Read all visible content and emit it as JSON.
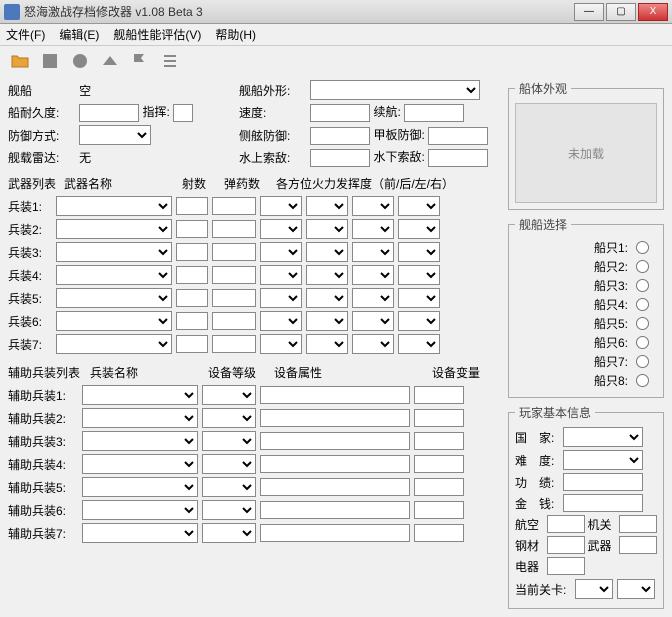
{
  "window": {
    "title": "怒海激战存档修改器 v1.08 Beta 3"
  },
  "menu": {
    "file": "文件(F)",
    "edit": "编辑(E)",
    "eval": "舰船性能评估(V)",
    "help": "帮助(H)"
  },
  "ship": {
    "ship_label": "舰船",
    "ship_value": "空",
    "shape_label": "舰船外形:",
    "hp_label": "船耐久度:",
    "command_label": "指挥:",
    "speed_label": "速度:",
    "range_label": "续航:",
    "defense_label": "防御方式:",
    "side_def_label": "侧舷防御:",
    "deck_def_label": "甲板防御:",
    "radar_label": "舰载雷达:",
    "radar_value": "无",
    "sonar_surface_label": "水上索敌:",
    "sonar_under_label": "水下索敌:"
  },
  "weapons": {
    "list_label": "武器列表",
    "name_label": "武器名称",
    "shots_label": "射数",
    "ammo_label": "弹药数",
    "dir_label": "各方位火力发挥度（前/后/左/右）",
    "rows": [
      "兵装1:",
      "兵装2:",
      "兵装3:",
      "兵装4:",
      "兵装5:",
      "兵装6:",
      "兵装7:"
    ]
  },
  "aux": {
    "list_label": "辅助兵装列表",
    "name_label": "兵装名称",
    "level_label": "设备等级",
    "attr_label": "设备属性",
    "var_label": "设备变量",
    "rows": [
      "辅助兵装1:",
      "辅助兵装2:",
      "辅助兵装3:",
      "辅助兵装4:",
      "辅助兵装5:",
      "辅助兵装6:",
      "辅助兵装7:"
    ]
  },
  "appearance": {
    "legend": "船体外观",
    "placeholder": "未加载"
  },
  "shipselect": {
    "legend": "舰船选择",
    "rows": [
      "船只1:",
      "船只2:",
      "船只3:",
      "船只4:",
      "船只5:",
      "船只6:",
      "船只7:",
      "船只8:"
    ]
  },
  "player": {
    "legend": "玩家基本信息",
    "country": "国　家:",
    "difficulty": "难　度:",
    "merit": "功　绩:",
    "money": "金　钱:",
    "air": "航空",
    "org": "机关",
    "steel": "钢材",
    "arms": "武器",
    "elec": "电器",
    "stage": "当前关卡:"
  }
}
